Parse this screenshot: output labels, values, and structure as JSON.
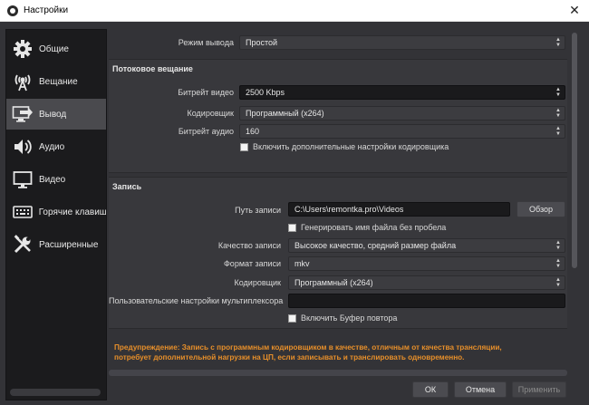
{
  "window": {
    "title": "Настройки",
    "close_glyph": "✕"
  },
  "sidebar": {
    "items": [
      {
        "label": "Общие",
        "icon": "gear-icon"
      },
      {
        "label": "Вещание",
        "icon": "broadcast-icon"
      },
      {
        "label": "Вывод",
        "icon": "output-icon",
        "active": true
      },
      {
        "label": "Аудио",
        "icon": "speaker-icon"
      },
      {
        "label": "Видео",
        "icon": "monitor-icon"
      },
      {
        "label": "Горячие клавиш",
        "icon": "keyboard-icon"
      },
      {
        "label": "Расширенные",
        "icon": "tools-icon"
      }
    ]
  },
  "output_mode": {
    "label": "Режим вывода",
    "value": "Простой"
  },
  "streaming": {
    "title": "Потоковое вещание",
    "video_bitrate": {
      "label": "Битрейт видео",
      "value": "2500 Kbps"
    },
    "encoder": {
      "label": "Кодировщик",
      "value": "Программный (x264)"
    },
    "audio_bitrate": {
      "label": "Битрейт аудио",
      "value": "160"
    },
    "advanced_checkbox": {
      "label": "Включить дополнительные настройки кодировщика",
      "checked": false
    }
  },
  "recording": {
    "title": "Запись",
    "path": {
      "label": "Путь записи",
      "value": "C:\\Users\\remontka.pro\\Videos",
      "browse_label": "Обзор"
    },
    "no_space_checkbox": {
      "label": "Генерировать имя файла без пробела",
      "checked": false
    },
    "quality": {
      "label": "Качество записи",
      "value": "Высокое качество, средний размер файла"
    },
    "format": {
      "label": "Формат записи",
      "value": "mkv"
    },
    "encoder": {
      "label": "Кодировщик",
      "value": "Программный (x264)"
    },
    "muxer": {
      "label": "Пользовательские настройки мультиплексора",
      "value": ""
    },
    "replay_buffer_checkbox": {
      "label": "Включить Буфер повтора",
      "checked": false
    }
  },
  "warning": {
    "line1": "Предупреждение: Запись с программным кодировщиком в качестве, отличным от качества трансляции,",
    "line2": "потребует дополнительной нагрузки на ЦП, если записывать и транслировать одновременно."
  },
  "buttons": {
    "ok": "ОК",
    "cancel": "Отмена",
    "apply": "Применить"
  },
  "colors": {
    "background": "#333337",
    "sidebar": "#1b1b1d",
    "active_item": "#4a4a4e",
    "warning": "#e78f2a"
  }
}
